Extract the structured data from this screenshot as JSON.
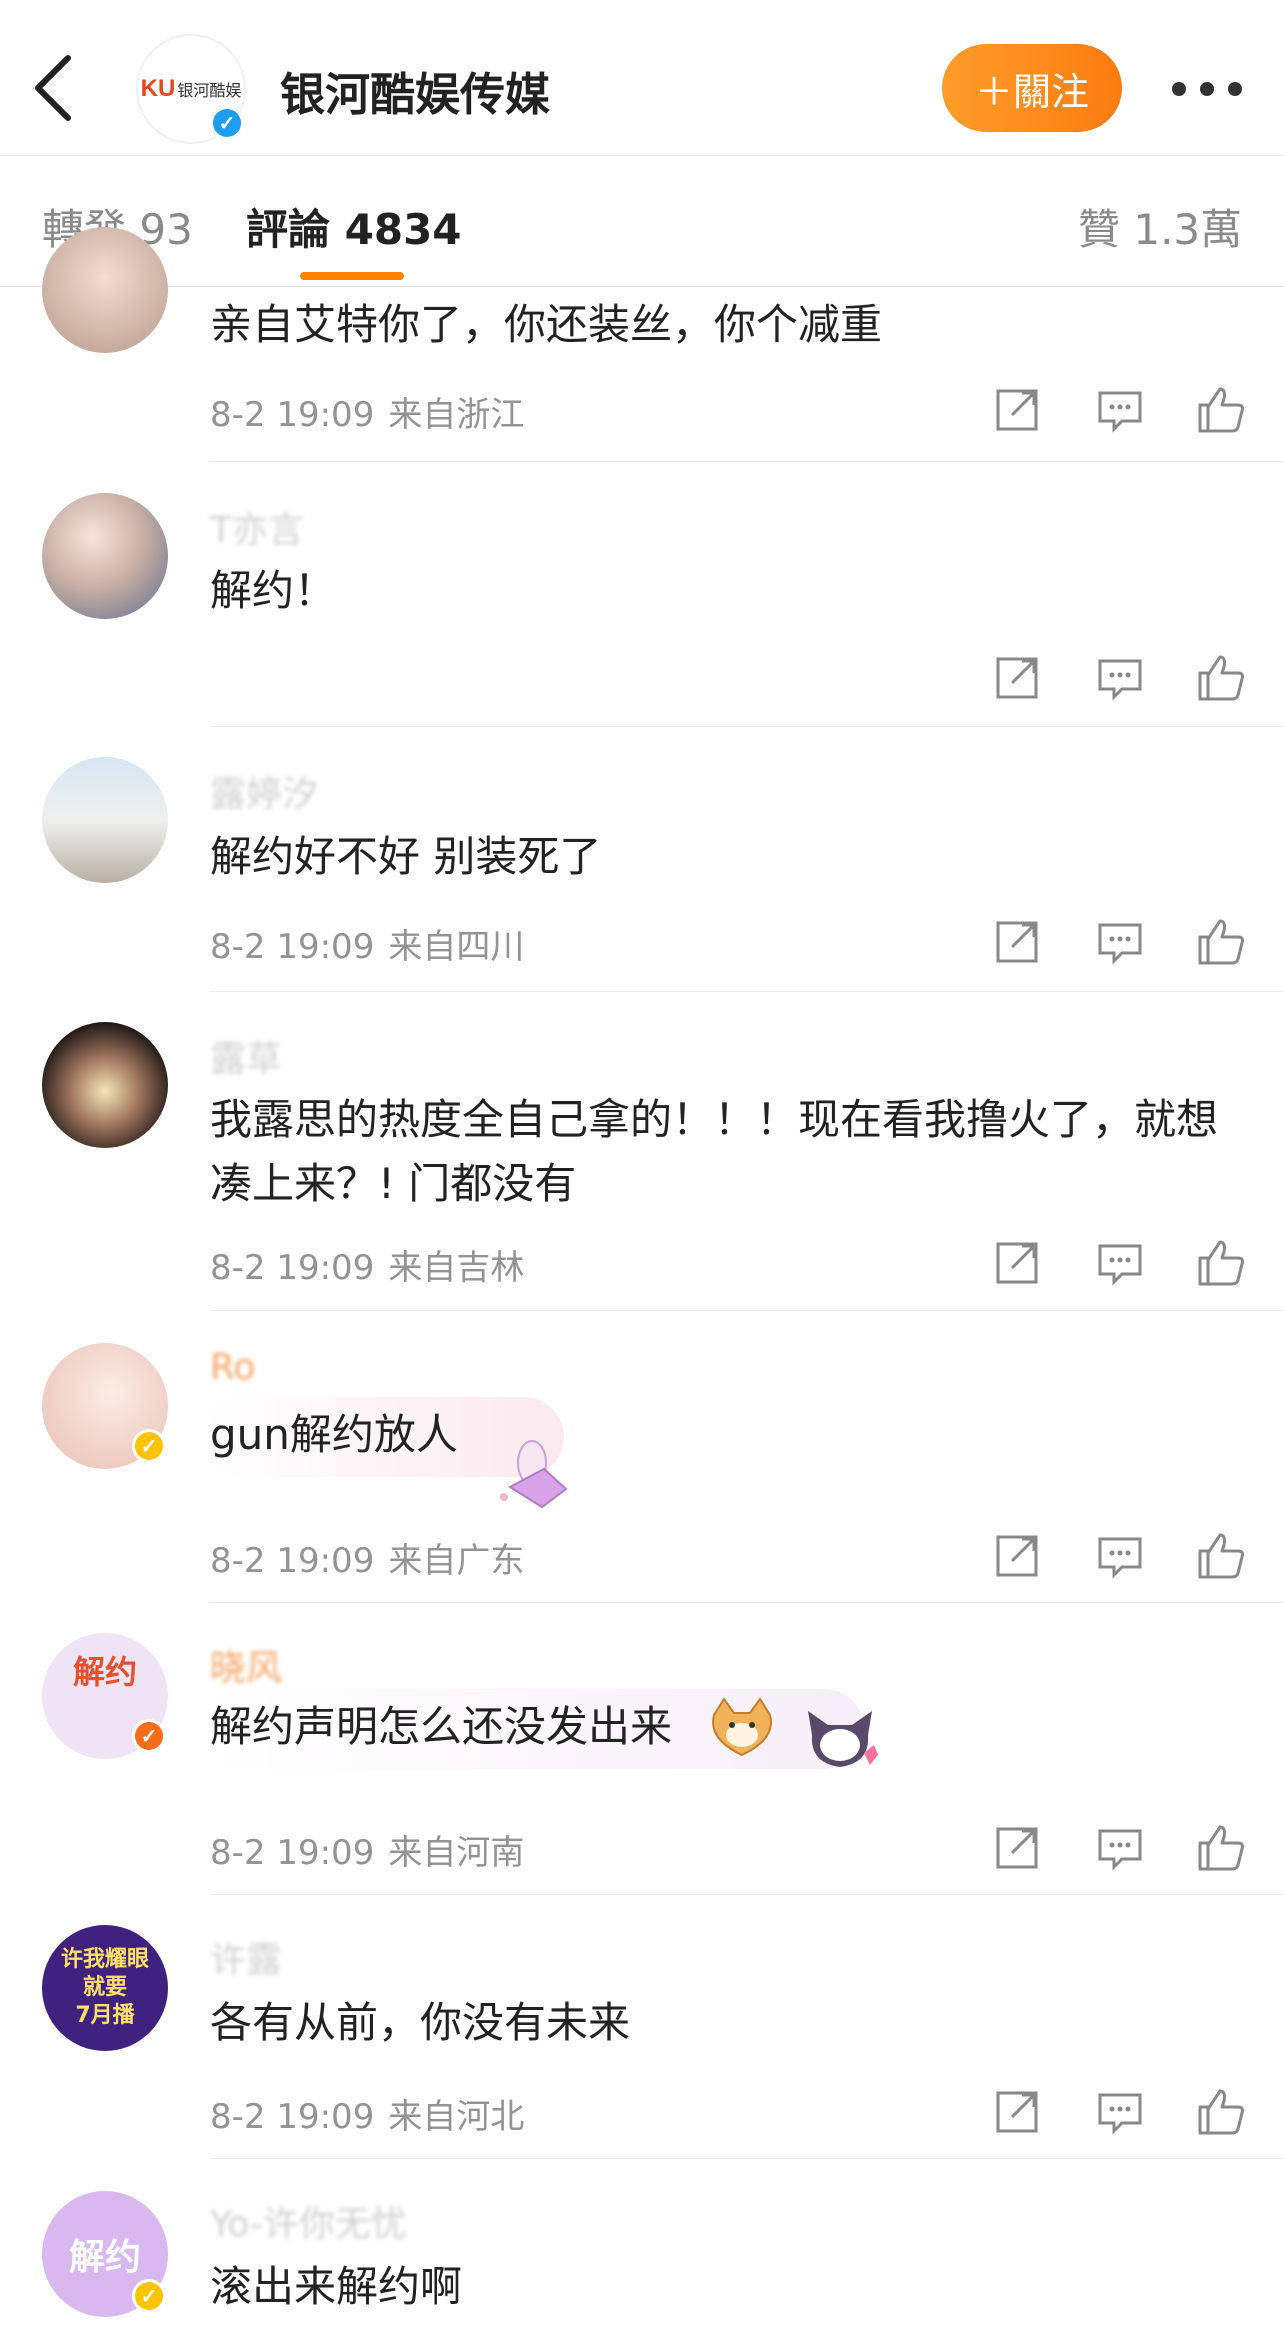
{
  "header": {
    "back_icon": "back-chevron-icon",
    "account_name": "银河酷娱传媒",
    "logo_mark": "KU",
    "logo_text": "银河酷娱",
    "follow_label": "＋關注",
    "more_icon": "more-dots-icon"
  },
  "tabs": {
    "repost": "轉發 93",
    "comments": "評論 4834",
    "likes": "贊 1.3萬"
  },
  "colors": {
    "accent": "#ff8200",
    "verified_blue": "#1f9df5",
    "verified_yellow": "#ffc300",
    "verified_orange": "#fa6b1a",
    "meta_gray": "#939393"
  },
  "comments": [
    {
      "username": "",
      "text": "亲自艾特你了，你还装丝，你个减重",
      "time": "8-2 19:09",
      "location": "来自浙江"
    },
    {
      "username": "T亦言",
      "text": "解约！",
      "time": "",
      "location": ""
    },
    {
      "username": "露婷汐",
      "text": "解约好不好 别装死了",
      "time": "8-2 19:09",
      "location": "来自四川"
    },
    {
      "username": "露草",
      "text": "我露思的热度全自己拿的！！！现在看我撸火了，就想凑上来？! 门都没有",
      "time": "8-2 19:09",
      "location": "来自吉林"
    },
    {
      "username": "Ro",
      "text": "gun解约放人",
      "time": "8-2 19:09",
      "location": "来自广东"
    },
    {
      "username": "晓风",
      "text": "解约声明怎么还没发出来",
      "time": "8-2 19:09",
      "location": "来自河南"
    },
    {
      "username": "许露",
      "text": "各有从前，你没有未来",
      "time": "8-2 19:09",
      "location": "来自河北"
    },
    {
      "username": "Yo-许你无忧",
      "text": "滚出来解约啊",
      "time": "",
      "location": ""
    }
  ],
  "avatar_texts": {
    "jieyue": "解约",
    "promo_line1": "许我耀眼",
    "promo_line2": "就要",
    "promo_line3": "7月播"
  },
  "action_icons": [
    "share-icon",
    "comment-icon",
    "like-icon"
  ]
}
